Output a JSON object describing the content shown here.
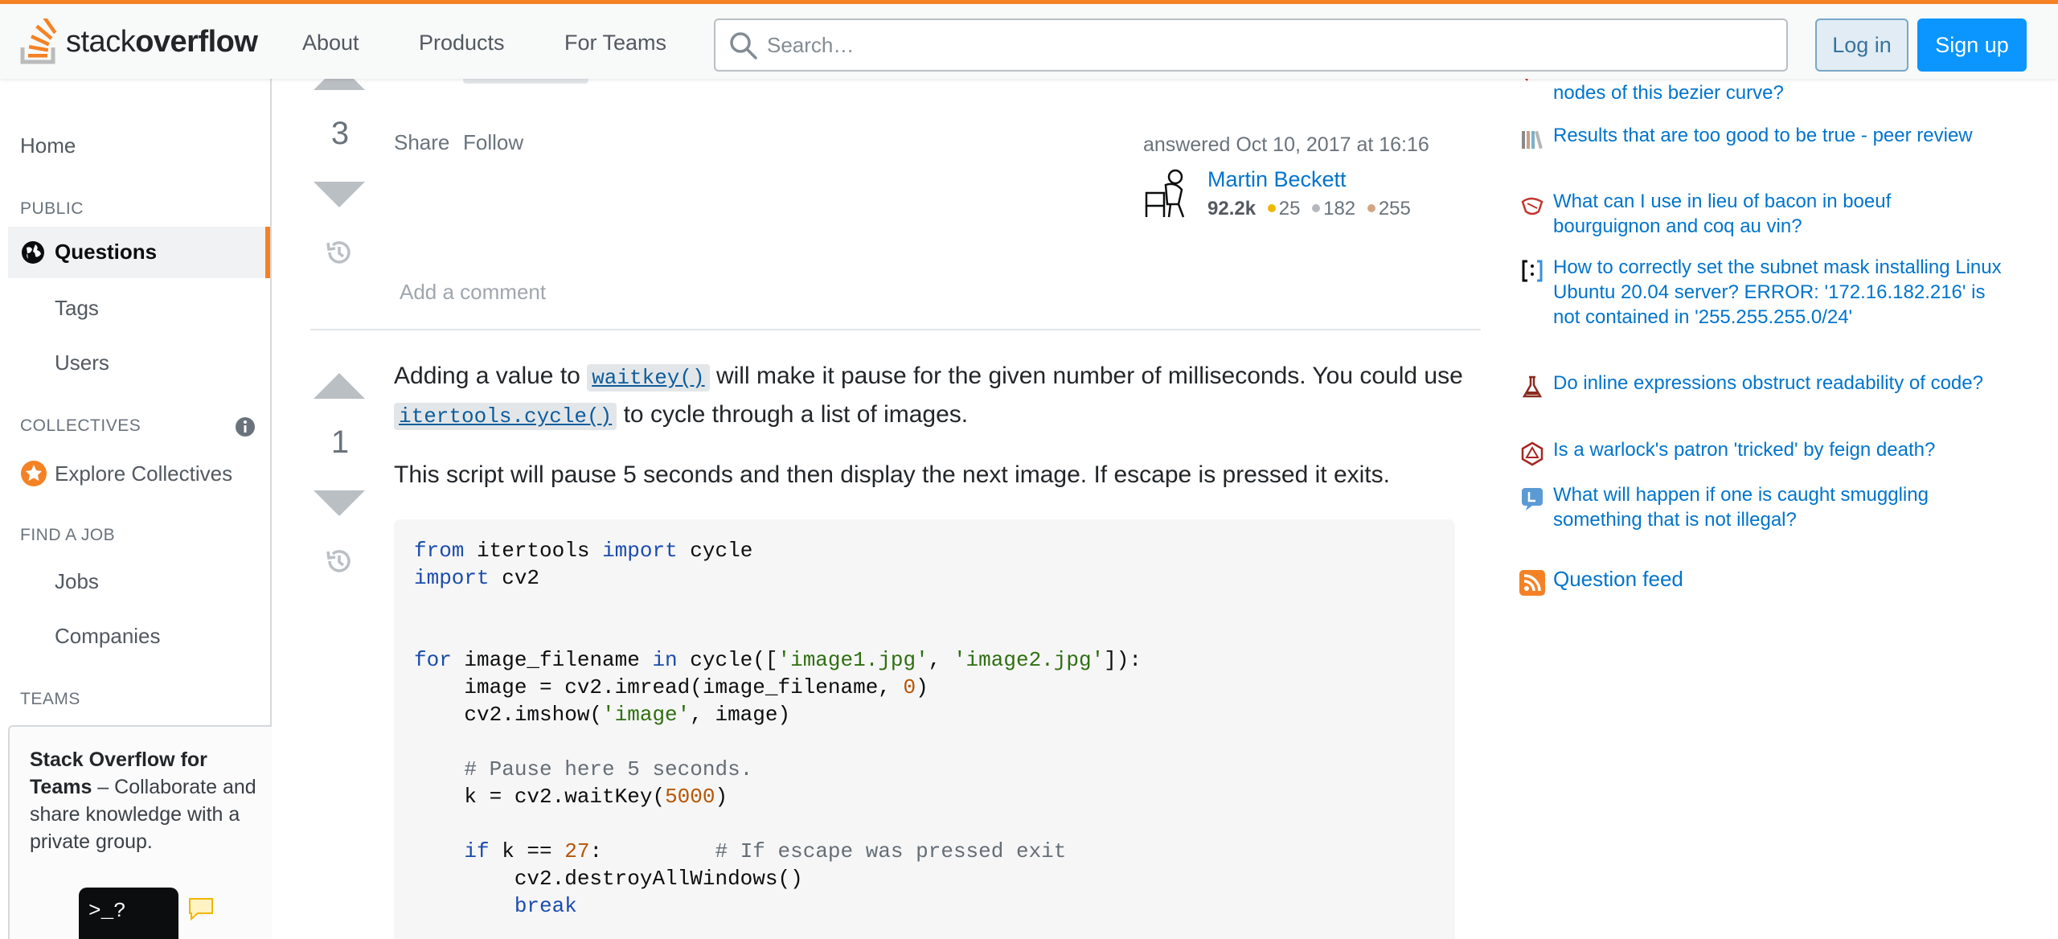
{
  "header": {
    "logo_text_light": "stack",
    "logo_text_bold": "overflow",
    "nav": [
      "About",
      "Products",
      "For Teams"
    ],
    "search_placeholder": "Search…",
    "login_label": "Log in",
    "signup_label": "Sign up",
    "accent_color": "#f48225",
    "signup_color": "#0a95ff"
  },
  "sidebar": {
    "home": "Home",
    "public_heading": "PUBLIC",
    "questions": "Questions",
    "tags": "Tags",
    "users": "Users",
    "collectives_heading": "COLLECTIVES",
    "explore_collectives": "Explore Collectives",
    "find_job_heading": "FIND A JOB",
    "jobs": "Jobs",
    "companies": "Companies",
    "teams_heading": "TEAMS",
    "teams_promo_title": "Stack Overflow for Teams",
    "teams_promo_body": " – Collaborate and share knowledge with a private group."
  },
  "answer1": {
    "votes": "3",
    "share": "Share",
    "follow": "Follow",
    "answered": "answered Oct 10, 2017 at 16:16",
    "user_name": "Martin Beckett",
    "reputation": "92.2k",
    "gold": "25",
    "silver": "182",
    "bronze": "255",
    "add_comment": "Add a comment"
  },
  "answer2": {
    "votes": "1",
    "p1_a": "Adding a value to ",
    "p1_code1": "waitkey()",
    "p1_b": " will make it pause for the given number of milliseconds. You could use ",
    "p1_code2": "itertools.cycle()",
    "p1_c": " to cycle through a list of images.",
    "p2": "This script will pause 5 seconds and then display the next image. If escape is pressed it exits.",
    "code": {
      "l1_kw": "from",
      "l1_a": " itertools ",
      "l1_kw2": "import",
      "l1_b": " cycle",
      "l2_kw": "import",
      "l2_a": " cv2",
      "l3_kw": "for",
      "l3_a": " image_filename ",
      "l3_kw2": "in",
      "l3_b": " cycle([",
      "l3_s1": "'image1.jpg'",
      "l3_c": ", ",
      "l3_s2": "'image2.jpg'",
      "l3_d": "]):",
      "l4_a": "    image = cv2.imread(image_filename, ",
      "l4_n": "0",
      "l4_b": ")",
      "l5_a": "    cv2.imshow(",
      "l5_s": "'image'",
      "l5_b": ", image)",
      "l6_cm": "    # Pause here 5 seconds.",
      "l7_a": "    k = cv2.waitKey(",
      "l7_n": "5000",
      "l7_b": ")",
      "l8_kw": "    if",
      "l8_a": " k == ",
      "l8_n": "27",
      "l8_b": ":         ",
      "l8_cm": "# If escape was pressed exit",
      "l9_a": "        cv2.destroyAllWindows()",
      "l10_kw": "        break"
    }
  },
  "hot_network": {
    "items": [
      "nodes of this bezier curve?",
      "Results that are too good to be true - peer review",
      "What can I use in lieu of bacon in boeuf bourguignon and coq au vin?",
      "How to correctly set the subnet mask installing Linux Ubuntu 20.04 server? ERROR: '172.16.182.216' is not contained in '255.255.255.0/24'",
      "Do inline expressions obstruct readability of code?",
      "Is a warlock's patron 'tricked' by feign death?",
      "What will happen if one is caught smuggling something that is not illegal?"
    ],
    "question_feed": "Question feed"
  },
  "widget": {
    "terminal_label": ">_?"
  }
}
